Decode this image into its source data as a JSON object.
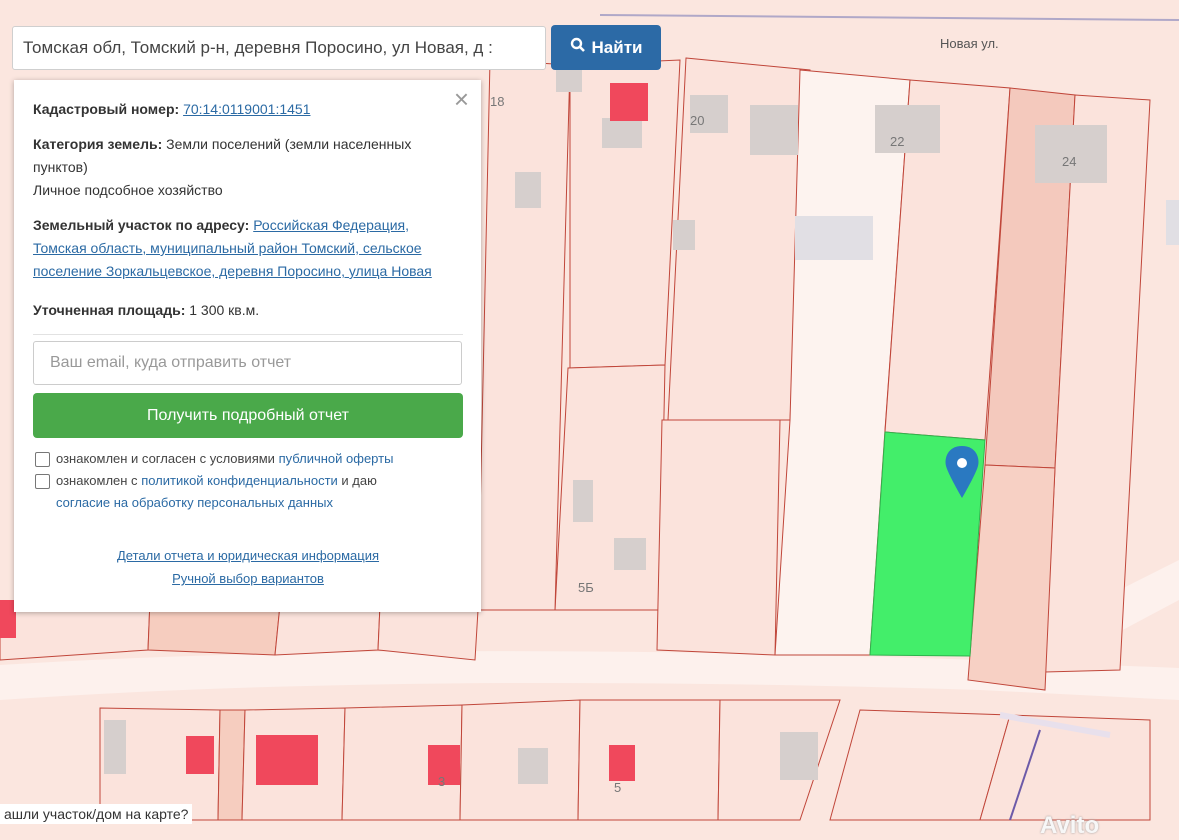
{
  "search": {
    "value": "Томская обл, Томский р-н, деревня Поросино, ул Новая, д :",
    "button_label": "Найти"
  },
  "map": {
    "street_label": "Новая ул.",
    "plot_numbers": [
      "18",
      "20",
      "22",
      "24",
      "5Б",
      "3",
      "5"
    ],
    "bottom_prompt": "ашли участок/дом на карте?",
    "selected_color": "#43ee6a",
    "parcel_fill": "#fbe3dc",
    "parcel_stroke": "#c0463a",
    "building_red": "#f0485c",
    "watermark": "Avito"
  },
  "panel": {
    "cadastral_label": "Кадастровый номер:",
    "cadastral_value": "70:14:0119001:1451",
    "category_label": "Категория земель:",
    "category_value": "Земли поселений (земли населенных пунктов)",
    "usage": "Личное подсобное хозяйство",
    "address_label": "Земельный участок по адресу:",
    "address_value": "Российская Федерация, Томская область, муниципальный район Томский, сельское поселение Зоркальцевское, деревня Поросино, улица Новая",
    "area_label": "Уточненная площадь:",
    "area_value": "1 300 кв.м.",
    "email_placeholder": "Ваш email, куда отправить отчет",
    "report_button": "Получить подробный отчет",
    "check1_text": "ознакомлен и согласен с условиями",
    "check1_link": "публичной оферты",
    "check2_text": "ознакомлен с",
    "check2_link": "политикой конфиденциальности",
    "check2_tail": "и даю",
    "check2_link2": "согласие на обработку персональных данных",
    "details_link": "Детали отчета и юридическая информация",
    "manual_link": "Ручной выбор вариантов"
  }
}
